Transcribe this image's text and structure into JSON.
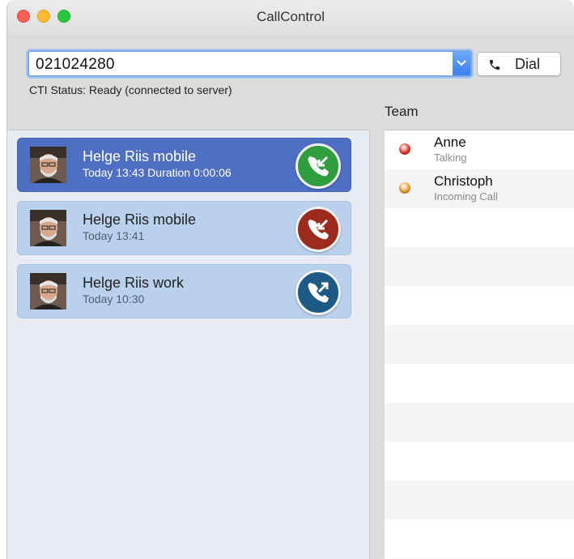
{
  "window": {
    "title": "CallControl"
  },
  "dialer": {
    "number_value": "021024280",
    "dial_label": "Dial",
    "status_text": "CTI Status: Ready (connected to server)"
  },
  "team": {
    "heading": "Team",
    "members": [
      {
        "name": "Anne",
        "status": "Talking",
        "dot_color": "#e8392c"
      },
      {
        "name": "Christoph",
        "status": "Incoming Call",
        "dot_color": "#f2a431"
      }
    ]
  },
  "calls": [
    {
      "name": "Helge Riis mobile",
      "meta": "Today 13:43 Duration 0:00:06",
      "type": "incoming-answered",
      "icon": "phone-incoming-icon",
      "color": "#2e9e3f",
      "selected": true
    },
    {
      "name": "Helge Riis mobile",
      "meta": "Today 13:41",
      "type": "incoming-missed",
      "icon": "phone-incoming-icon",
      "color": "#9c2b1d",
      "selected": false
    },
    {
      "name": "Helge Riis work",
      "meta": "Today 10:30",
      "type": "outgoing",
      "icon": "phone-outgoing-icon",
      "color": "#1d5a86",
      "selected": false
    }
  ]
}
